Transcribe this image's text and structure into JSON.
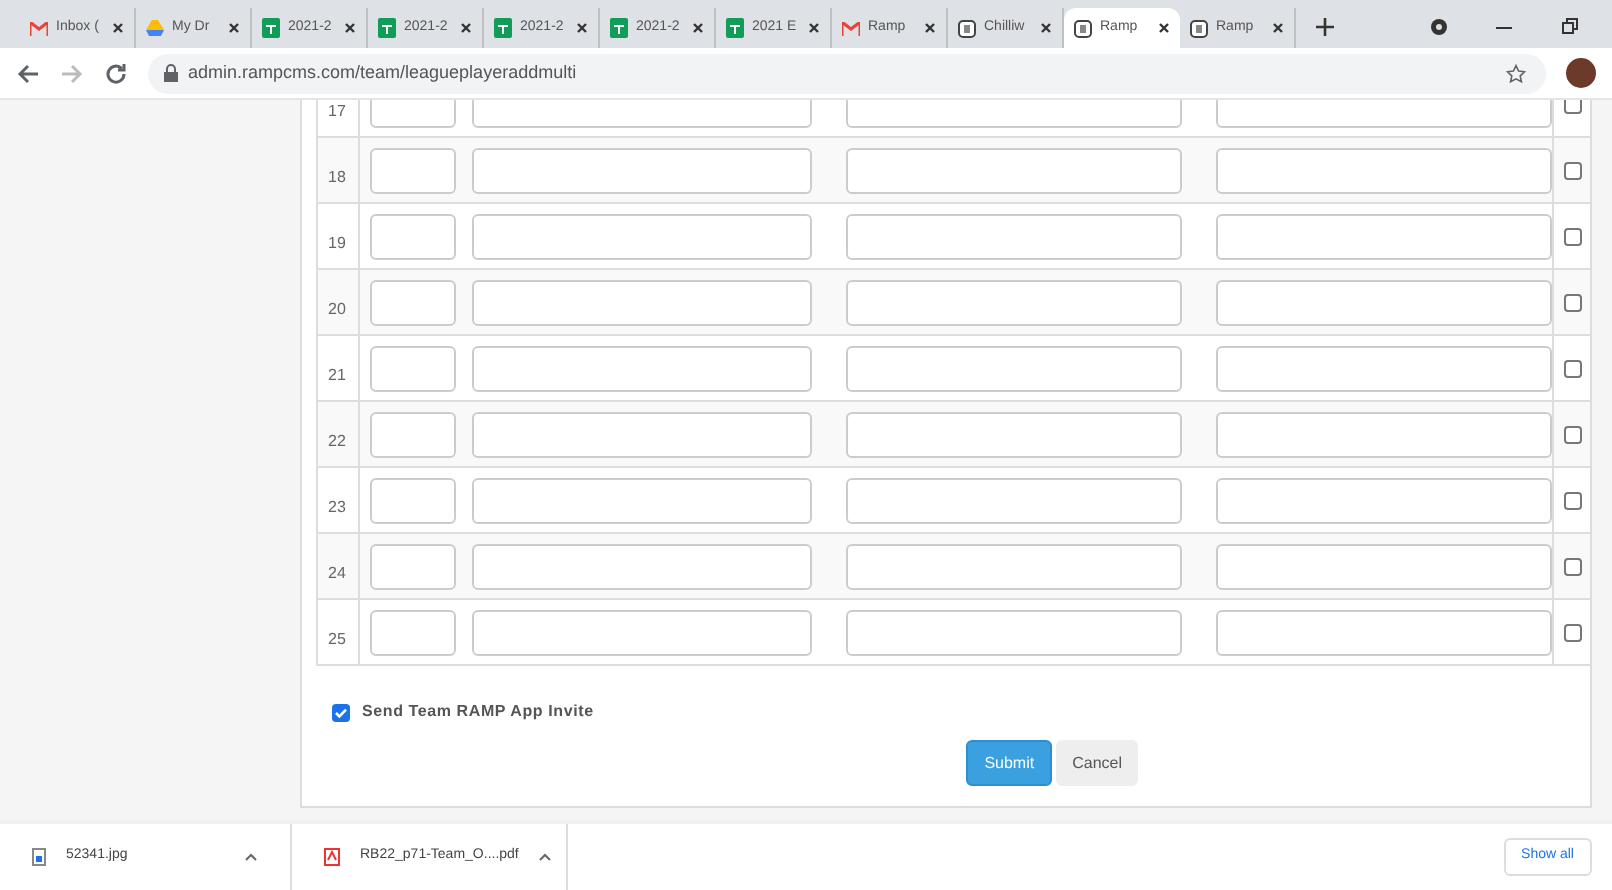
{
  "tabs": [
    {
      "title": "Inbox (",
      "kind": "mail",
      "selected": false
    },
    {
      "title": "My Dr",
      "kind": "drive",
      "selected": false
    },
    {
      "title": "2021-2",
      "kind": "sheet",
      "selected": false
    },
    {
      "title": "2021-2",
      "kind": "sheet",
      "selected": false
    },
    {
      "title": "2021-2",
      "kind": "sheet",
      "selected": false
    },
    {
      "title": "2021-2",
      "kind": "sheet",
      "selected": false
    },
    {
      "title": "2021 E",
      "kind": "sheet",
      "selected": false
    },
    {
      "title": "Ramp",
      "kind": "mail",
      "selected": false
    },
    {
      "title": "Chilliw",
      "kind": "site",
      "selected": false
    },
    {
      "title": "Ramp",
      "kind": "site",
      "selected": true
    },
    {
      "title": "Ramp",
      "kind": "site",
      "selected": false
    }
  ],
  "address": "admin.rampcms.com/team/leagueplayeraddmulti",
  "rows": [
    {
      "number": "17",
      "checked": false
    },
    {
      "number": "18",
      "checked": false
    },
    {
      "number": "19",
      "checked": false
    },
    {
      "number": "20",
      "checked": false
    },
    {
      "number": "21",
      "checked": false
    },
    {
      "number": "22",
      "checked": false
    },
    {
      "number": "23",
      "checked": false
    },
    {
      "number": "24",
      "checked": false
    },
    {
      "number": "25",
      "checked": false
    }
  ],
  "invite": {
    "label": "Send Team RAMP App Invite",
    "checked": true
  },
  "buttons": [
    {
      "label": "Submit",
      "kind": "primary"
    },
    {
      "label": "Cancel",
      "kind": "secondary"
    }
  ],
  "downloads": [
    {
      "name": "52341.jpg",
      "kind": "image"
    },
    {
      "name": "RB22_p71-Team_O....pdf",
      "kind": "pdf"
    }
  ],
  "show_all": "Show all"
}
